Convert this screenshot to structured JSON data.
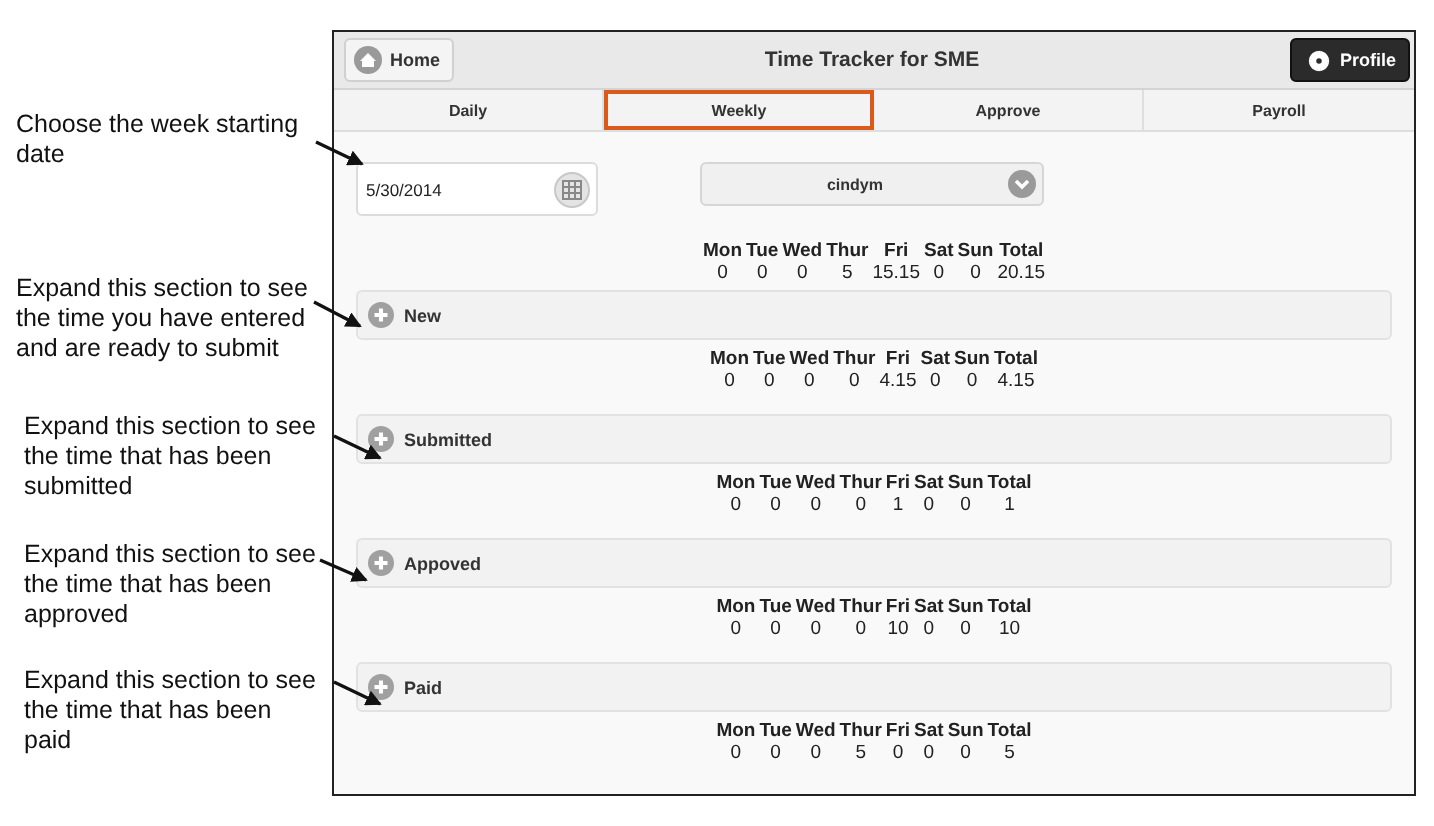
{
  "annotations": [
    {
      "lines": [
        "Choose the week starting",
        "date"
      ]
    },
    {
      "lines": [
        "Expand this section to see",
        "the time you have entered",
        "and are ready to submit"
      ]
    },
    {
      "lines": [
        "Expand this section to see",
        "the time that has been",
        "submitted"
      ]
    },
    {
      "lines": [
        "Expand this section to see",
        "the time that has been",
        "approved"
      ]
    },
    {
      "lines": [
        "Expand this section to see",
        "the time that has been",
        "paid"
      ]
    }
  ],
  "app": {
    "home_button": "Home",
    "title": "Time Tracker for SME",
    "profile_button": "Profile",
    "tabs": [
      {
        "label": "Daily",
        "selected": false
      },
      {
        "label": "Weekly",
        "selected": true
      },
      {
        "label": "Approve",
        "selected": false
      },
      {
        "label": "Payroll",
        "selected": false
      }
    ],
    "date_field": {
      "value": "5/30/2014"
    },
    "user_select": {
      "value": "cindym"
    },
    "weekly_summary": {
      "columns": [
        "Mon",
        "Tue",
        "Wed",
        "Thur",
        "Fri",
        "Sat",
        "Sun",
        "Total"
      ],
      "values": [
        "0",
        "0",
        "0",
        "5",
        "15.15",
        "0",
        "0",
        "20.15"
      ]
    },
    "sections": [
      {
        "label": "New",
        "expanded": false,
        "summary": {
          "columns": [
            "Mon",
            "Tue",
            "Wed",
            "Thur",
            "Fri",
            "Sat",
            "Sun",
            "Total"
          ],
          "values": [
            "0",
            "0",
            "0",
            "0",
            "4.15",
            "0",
            "0",
            "4.15"
          ]
        }
      },
      {
        "label": "Submitted",
        "expanded": false,
        "summary": {
          "columns": [
            "Mon",
            "Tue",
            "Wed",
            "Thur",
            "Fri",
            "Sat",
            "Sun",
            "Total"
          ],
          "values": [
            "0",
            "0",
            "0",
            "0",
            "1",
            "0",
            "0",
            "1"
          ]
        }
      },
      {
        "label": "Appoved",
        "expanded": false,
        "summary": {
          "columns": [
            "Mon",
            "Tue",
            "Wed",
            "Thur",
            "Fri",
            "Sat",
            "Sun",
            "Total"
          ],
          "values": [
            "0",
            "0",
            "0",
            "0",
            "10",
            "0",
            "0",
            "10"
          ]
        }
      },
      {
        "label": "Paid",
        "expanded": false,
        "summary": {
          "columns": [
            "Mon",
            "Tue",
            "Wed",
            "Thur",
            "Fri",
            "Sat",
            "Sun",
            "Total"
          ],
          "values": [
            "0",
            "0",
            "0",
            "5",
            "0",
            "0",
            "0",
            "5"
          ]
        }
      }
    ]
  }
}
